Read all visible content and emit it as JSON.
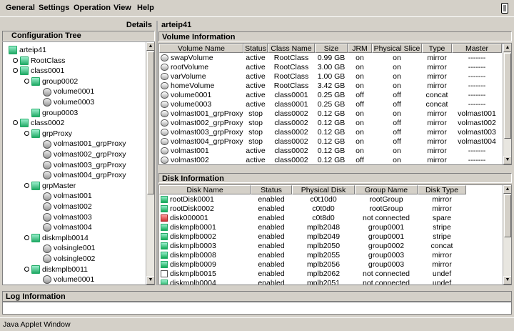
{
  "menu": [
    "General",
    "Settings",
    "Operation",
    "View",
    "Help"
  ],
  "left_panel": {
    "title": "Details",
    "tree_header": "Configuration Tree"
  },
  "tree": [
    {
      "label": "arteip41",
      "level": 0,
      "icon": "host-icon",
      "toggle": false
    },
    {
      "label": "RootClass",
      "level": 1,
      "icon": "class-icon",
      "toggle": true
    },
    {
      "label": "class0001",
      "level": 1,
      "icon": "class-icon",
      "toggle": true
    },
    {
      "label": "group0002",
      "level": 2,
      "icon": "group-icon",
      "toggle": true
    },
    {
      "label": "volume0001",
      "level": 3,
      "icon": "volume-icon",
      "toggle": false
    },
    {
      "label": "volume0003",
      "level": 3,
      "icon": "volume-icon",
      "toggle": false
    },
    {
      "label": "group0003",
      "level": 2,
      "icon": "group-icon",
      "toggle": false
    },
    {
      "label": "class0002",
      "level": 1,
      "icon": "class-icon",
      "toggle": true
    },
    {
      "label": "grpProxy",
      "level": 2,
      "icon": "group-icon",
      "toggle": true
    },
    {
      "label": "volmast001_grpProxy",
      "level": 3,
      "icon": "proxy-volume-icon",
      "toggle": false
    },
    {
      "label": "volmast002_grpProxy",
      "level": 3,
      "icon": "proxy-volume-icon",
      "toggle": false
    },
    {
      "label": "volmast003_grpProxy",
      "level": 3,
      "icon": "proxy-volume-icon",
      "toggle": false
    },
    {
      "label": "volmast004_grpProxy",
      "level": 3,
      "icon": "proxy-volume-icon",
      "toggle": false
    },
    {
      "label": "grpMaster",
      "level": 2,
      "icon": "group-icon",
      "toggle": true
    },
    {
      "label": "volmast001",
      "level": 3,
      "icon": "volume-icon",
      "toggle": false
    },
    {
      "label": "volmast002",
      "level": 3,
      "icon": "volume-icon",
      "toggle": false
    },
    {
      "label": "volmast003",
      "level": 3,
      "icon": "volume-icon",
      "toggle": false
    },
    {
      "label": "volmast004",
      "level": 3,
      "icon": "volume-icon",
      "toggle": false
    },
    {
      "label": "diskmplb0014",
      "level": 2,
      "icon": "disk-icon",
      "toggle": true
    },
    {
      "label": "volsingle001",
      "level": 3,
      "icon": "volume-icon",
      "toggle": false
    },
    {
      "label": "volsingle002",
      "level": 3,
      "icon": "volume-icon",
      "toggle": false
    },
    {
      "label": "diskmplb0011",
      "level": 2,
      "icon": "disk-icon",
      "toggle": true
    },
    {
      "label": "volume0001",
      "level": 3,
      "icon": "volume-icon",
      "toggle": false
    }
  ],
  "right_panel": {
    "title": "arteip41"
  },
  "volume_info": {
    "title": "Volume Information",
    "columns": [
      "Volume Name",
      "Status",
      "Class Name",
      "Size",
      "JRM",
      "Physical Slice",
      "Type",
      "Master"
    ],
    "rows": [
      [
        "swapVolume",
        "active",
        "RootClass",
        "0.99 GB",
        "on",
        "on",
        "mirror",
        "-------"
      ],
      [
        "rootVolume",
        "active",
        "RootClass",
        "3.00 GB",
        "on",
        "on",
        "mirror",
        "-------"
      ],
      [
        "varVolume",
        "active",
        "RootClass",
        "1.00 GB",
        "on",
        "on",
        "mirror",
        "-------"
      ],
      [
        "homeVolume",
        "active",
        "RootClass",
        "3.42 GB",
        "on",
        "on",
        "mirror",
        "-------"
      ],
      [
        "volume0001",
        "active",
        "class0001",
        "0.25 GB",
        "off",
        "off",
        "concat",
        "-------"
      ],
      [
        "volume0003",
        "active",
        "class0001",
        "0.25 GB",
        "off",
        "off",
        "concat",
        "-------"
      ],
      [
        "volmast001_grpProxy",
        "stop",
        "class0002",
        "0.12 GB",
        "on",
        "on",
        "mirror",
        "volmast001"
      ],
      [
        "volmast002_grpProxy",
        "stop",
        "class0002",
        "0.12 GB",
        "on",
        "off",
        "mirror",
        "volmast002"
      ],
      [
        "volmast003_grpProxy",
        "stop",
        "class0002",
        "0.12 GB",
        "on",
        "off",
        "mirror",
        "volmast003"
      ],
      [
        "volmast004_grpProxy",
        "stop",
        "class0002",
        "0.12 GB",
        "on",
        "off",
        "mirror",
        "volmast004"
      ],
      [
        "volmast001",
        "active",
        "class0002",
        "0.12 GB",
        "on",
        "on",
        "mirror",
        "-------"
      ],
      [
        "volmast002",
        "active",
        "class0002",
        "0.12 GB",
        "off",
        "on",
        "mirror",
        "-------"
      ]
    ]
  },
  "disk_info": {
    "title": "Disk Information",
    "columns": [
      "Disk Name",
      "Status",
      "Physical Disk",
      "Group Name",
      "Disk Type"
    ],
    "rows": [
      [
        "rootDisk0001",
        "enabled",
        "c0t10d0",
        "rootGroup",
        "mirror",
        "green"
      ],
      [
        "rootDisk0002",
        "enabled",
        "c0t0d0",
        "rootGroup",
        "mirror",
        "green"
      ],
      [
        "disk000001",
        "enabled",
        "c0t8d0",
        "not connected",
        "spare",
        "red"
      ],
      [
        "diskmplb0001",
        "enabled",
        "mplb2048",
        "group0001",
        "stripe",
        "green"
      ],
      [
        "diskmplb0002",
        "enabled",
        "mplb2049",
        "group0001",
        "stripe",
        "green"
      ],
      [
        "diskmplb0003",
        "enabled",
        "mplb2050",
        "group0002",
        "concat",
        "green"
      ],
      [
        "diskmplb0008",
        "enabled",
        "mplb2055",
        "group0003",
        "mirror",
        "green"
      ],
      [
        "diskmplb0009",
        "enabled",
        "mplb2056",
        "group0003",
        "mirror",
        "green"
      ],
      [
        "diskmplb0015",
        "enabled",
        "mplb2062",
        "not connected",
        "undef",
        "blank"
      ],
      [
        "diskmplb0004",
        "enabled",
        "mplb2051",
        "not connected",
        "undef",
        "green"
      ]
    ]
  },
  "log": {
    "title": "Log Information"
  },
  "status_bar": "Java Applet Window"
}
